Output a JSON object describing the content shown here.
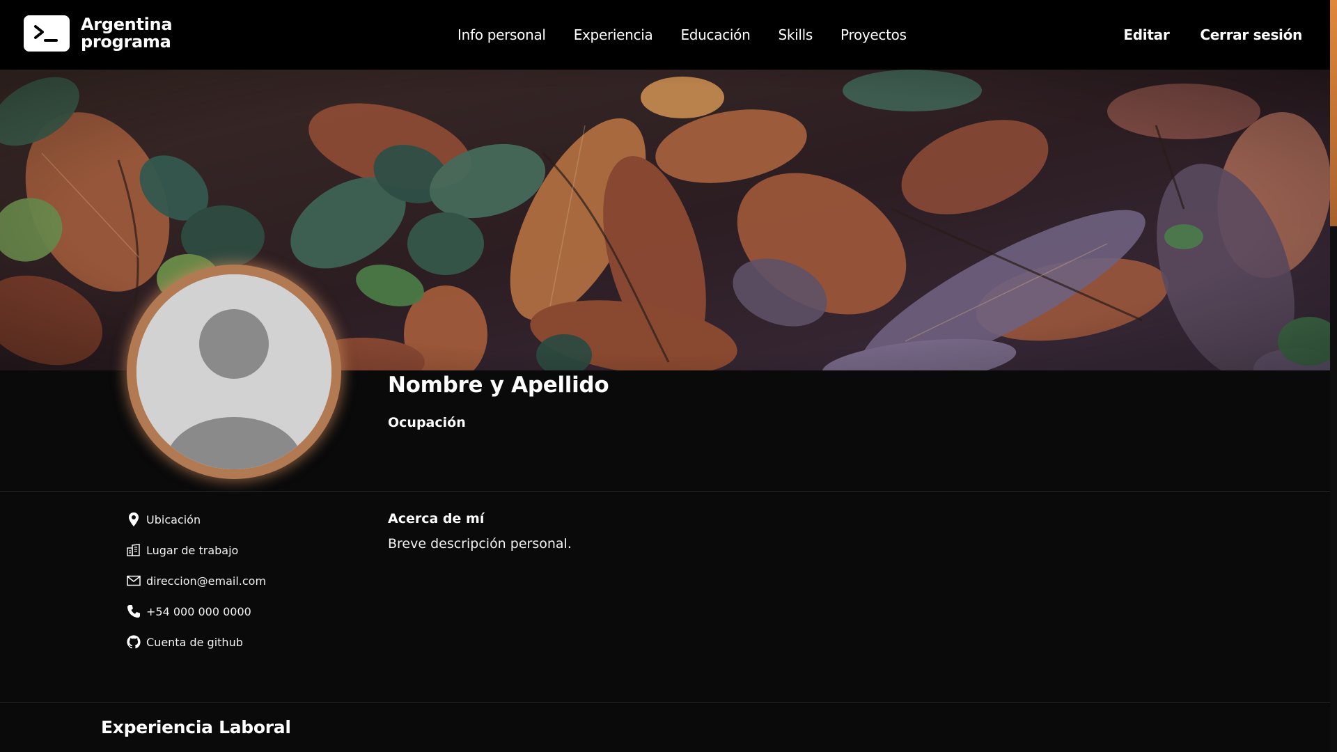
{
  "brand": {
    "line1": "Argentina",
    "line2": "programa",
    "logo_icon": "terminal-prompt-icon"
  },
  "nav": {
    "links": [
      "Info personal",
      "Experiencia",
      "Educación",
      "Skills",
      "Proyectos"
    ],
    "edit_label": "Editar",
    "logout_label": "Cerrar sesión"
  },
  "profile": {
    "name": "Nombre y Apellido",
    "occupation": "Ocupación",
    "avatar_icon": "default-user-avatar"
  },
  "contact": {
    "location": "Ubicación",
    "workplace": "Lugar de trabajo",
    "email": "direccion@email.com",
    "phone": "+54 000 000 0000",
    "github": "Cuenta de github"
  },
  "about": {
    "title": "Acerca de mí",
    "text": "Breve descripción personal."
  },
  "experience": {
    "title": "Experiencia Laboral"
  },
  "colors": {
    "background": "#0a0a0b",
    "navbar": "#000000",
    "accent": "#d68e5c",
    "avatar_ring": "#b27a52"
  }
}
